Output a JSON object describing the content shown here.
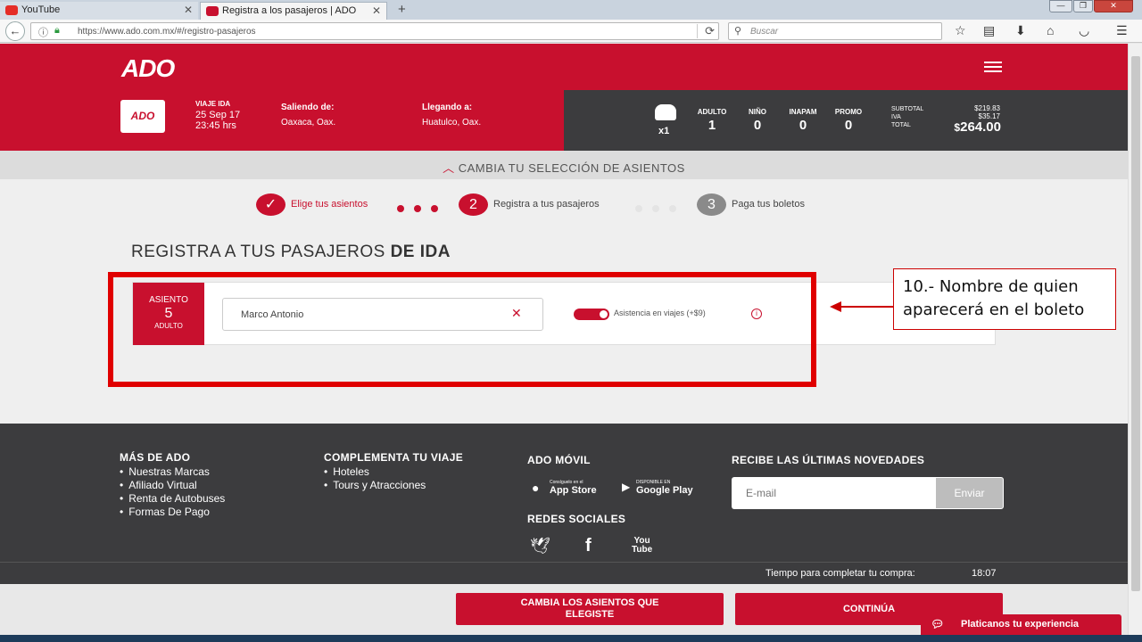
{
  "browser": {
    "tabs": [
      {
        "label": "YouTube",
        "active": false
      },
      {
        "label": "Registra a los pasajeros | ADO",
        "active": true
      }
    ],
    "url": "https://www.ado.com.mx/#/registro-pasajeros",
    "search_placeholder": "Buscar"
  },
  "header": {
    "logo": "ADO"
  },
  "trip": {
    "badge": "ADO",
    "trip_label": "VIAJE IDA",
    "date": "25 Sep 17",
    "time": "23:45 hrs",
    "origin_label": "Saliendo de:",
    "origin": "Oaxaca, Oax.",
    "destination_label": "Llegando a:",
    "destination": "Huatulco, Oax.",
    "seat_count": "x1",
    "counts": [
      {
        "label": "ADULTO",
        "value": "1"
      },
      {
        "label": "NIÑO",
        "value": "0"
      },
      {
        "label": "INAPAM",
        "value": "0"
      },
      {
        "label": "PROMO",
        "value": "0"
      }
    ],
    "subtotal_label": "SUBTOTAL",
    "subtotal": "$219.83",
    "iva_label": "IVA",
    "iva": "$35.17",
    "total_label": "TOTAL",
    "total_currency": "$",
    "total": "264.00"
  },
  "change_seats": "CAMBIA TU SELECCIÓN DE ASIENTOS",
  "steps": [
    {
      "number": "✓",
      "label": "Elige tus asientos",
      "state": "done"
    },
    {
      "number": "2",
      "label": "Registra a tus pasajeros",
      "state": "current"
    },
    {
      "number": "3",
      "label": "Paga tus boletos",
      "state": "pending"
    }
  ],
  "page_title": {
    "prefix": "REGISTRA A TUS PASAJEROS",
    "bold": "DE IDA"
  },
  "passenger": {
    "seat_label": "ASIENTO",
    "seat_number": "5",
    "seat_type": "ADULTO",
    "name_value": "Marco Antonio",
    "assist_label": "Asistencia en viajes (+$9)",
    "assist_enabled": true
  },
  "annotation": {
    "line1": "10.- Nombre de quien",
    "line2": "aparecerá en el boleto"
  },
  "footer": {
    "more_title": "MÁS DE ADO",
    "more_items": [
      "Nuestras Marcas",
      "Afiliado Virtual",
      "Renta de Autobuses",
      "Formas De Pago"
    ],
    "complement_title": "COMPLEMENTA TU VIAJE",
    "complement_items": [
      "Hoteles",
      "Tours y Atracciones"
    ],
    "mobile_title": "ADO MÓVIL",
    "app_store_small": "Consíguelo en el",
    "app_store": "App Store",
    "google_play_small": "DISPONIBLE EN",
    "google_play": "Google Play",
    "social_title": "REDES SOCIALES",
    "news_title": "RECIBE LAS ÚLTIMAS NOVEDADES",
    "email_placeholder": "E-mail",
    "send_label": "Enviar"
  },
  "timer": {
    "label": "Tiempo para completar tu compra:",
    "value": "18:07"
  },
  "actions": {
    "change_seats_line1": "CAMBIA LOS ASIENTOS QUE",
    "change_seats_line2": "ELEGISTE",
    "continue": "CONTINÚA"
  },
  "chat": {
    "label": "Platicanos tu experiencia"
  },
  "colors": {
    "brand_red": "#c8102e",
    "dark": "#3c3c3e",
    "highlight": "#e00000"
  }
}
